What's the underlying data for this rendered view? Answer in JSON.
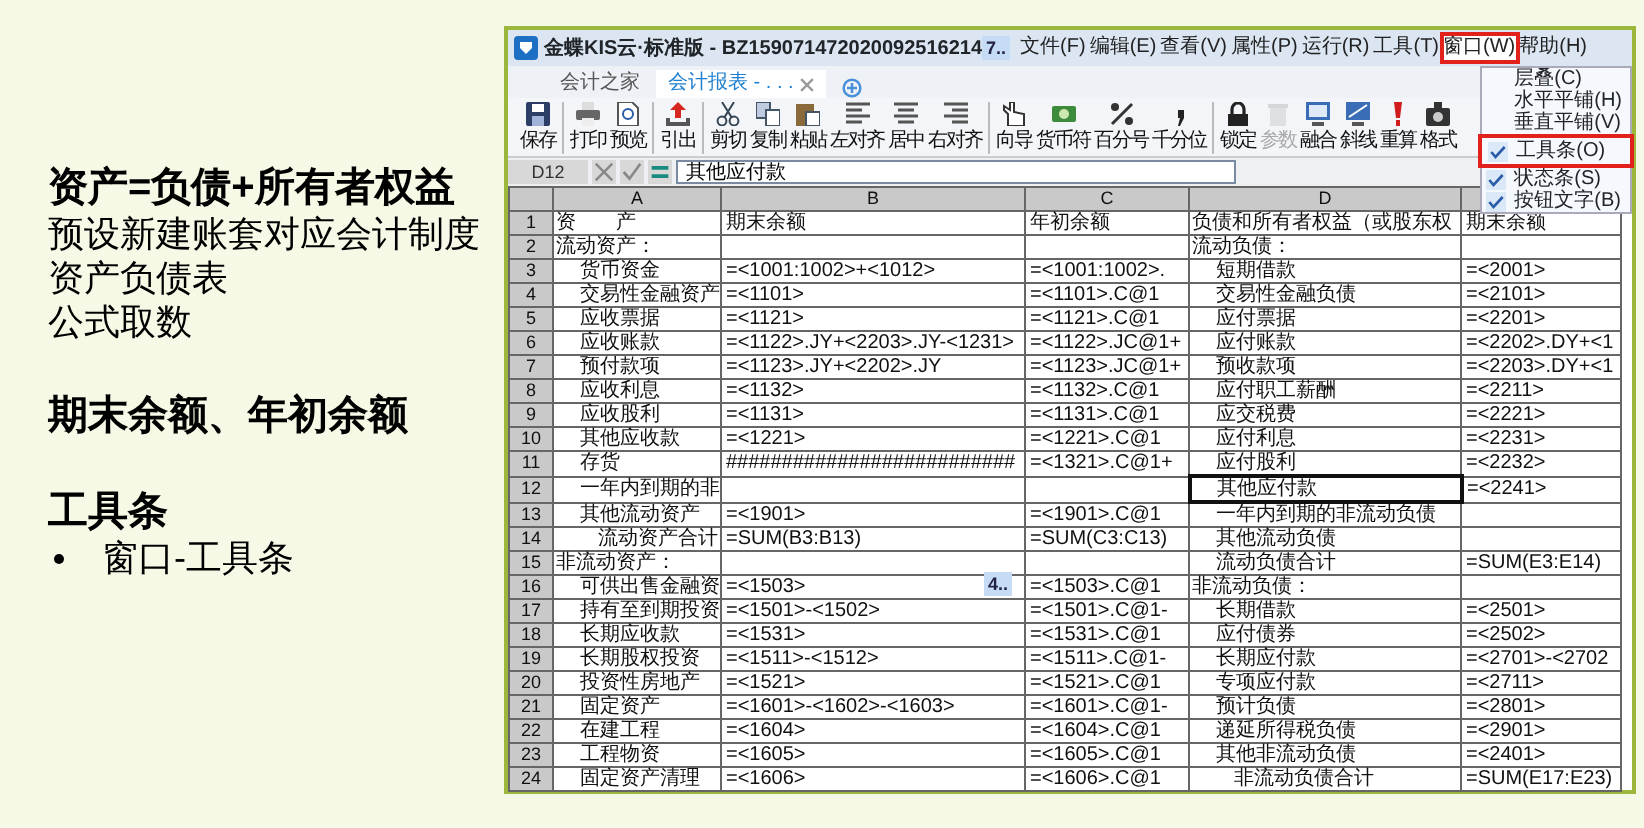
{
  "slide": {
    "sections": [
      {
        "heading": "资产=负债+所有者权益",
        "lines": [
          "预设新建账套对应会计制度",
          "资产负债表",
          "公式取数"
        ]
      },
      {
        "heading": "期末余额、年初余额"
      },
      {
        "heading": "工具条",
        "bullets": [
          "窗口-工具条"
        ]
      }
    ]
  },
  "window": {
    "title": "金蝶KIS云·标准版 - BZ159071472020092516214",
    "tooltip": "7..",
    "menus": [
      {
        "label": "文件(F)",
        "selected": false,
        "annotated": false
      },
      {
        "label": "编辑(E)",
        "selected": false,
        "annotated": false
      },
      {
        "label": "查看(V)",
        "selected": false,
        "annotated": false
      },
      {
        "label": "属性(P)",
        "selected": false,
        "annotated": false
      },
      {
        "label": "运行(R)",
        "selected": false,
        "annotated": false
      },
      {
        "label": "工具(T)",
        "selected": false,
        "annotated": false
      },
      {
        "label": "窗口(W)",
        "selected": true,
        "annotated": true
      },
      {
        "label": "帮助(H)",
        "selected": false,
        "annotated": false
      }
    ]
  },
  "window_menu": {
    "items": [
      {
        "label": "层叠(C)",
        "checked": false,
        "annotated": false
      },
      {
        "label": "水平平铺(H)",
        "checked": false,
        "annotated": false
      },
      {
        "label": "垂直平铺(V)",
        "checked": false,
        "annotated": false
      },
      {
        "label": "工具条(O)",
        "checked": true,
        "annotated": true
      },
      {
        "label": "状态条(S)",
        "checked": true,
        "annotated": false
      },
      {
        "label": "按钮文字(B)",
        "checked": true,
        "annotated": false
      }
    ]
  },
  "tabs": [
    {
      "label": "会计之家",
      "selected": false,
      "closable": false
    },
    {
      "label": "会计报表 - . . .",
      "selected": true,
      "closable": true
    }
  ],
  "toolbar": {
    "groups": [
      [
        {
          "label": "保存",
          "disabled": false
        }
      ],
      [
        {
          "label": "打印",
          "disabled": false
        },
        {
          "label": "预览",
          "disabled": false
        }
      ],
      [
        {
          "label": "引出",
          "disabled": false
        }
      ],
      [
        {
          "label": "剪切",
          "disabled": false
        },
        {
          "label": "复制",
          "disabled": false
        },
        {
          "label": "粘贴",
          "disabled": false
        },
        {
          "label": "左对齐",
          "disabled": false
        },
        {
          "label": "居中",
          "disabled": false
        },
        {
          "label": "右对齐",
          "disabled": false
        }
      ],
      [
        {
          "label": "向导",
          "disabled": false
        },
        {
          "label": "货币符",
          "disabled": false
        },
        {
          "label": "百分号",
          "disabled": false
        },
        {
          "label": "千分位",
          "disabled": false
        }
      ],
      [
        {
          "label": "锁定",
          "disabled": false
        },
        {
          "label": "参数",
          "disabled": true
        },
        {
          "label": "融合",
          "disabled": false
        },
        {
          "label": "斜线",
          "disabled": false
        },
        {
          "label": "重算",
          "disabled": false
        },
        {
          "label": "格式",
          "disabled": false
        }
      ]
    ]
  },
  "formula_bar": {
    "cell": "D12",
    "value": "其他应付款"
  },
  "sheet": {
    "columns": [
      "A",
      "B",
      "C",
      "D"
    ],
    "tooltip": "4..",
    "rows": [
      {
        "number": "1",
        "a": {
          "text": "资　　产",
          "kind": "section"
        },
        "b": "期末余额",
        "c": "年初余额",
        "d": {
          "text": "负债和所有者权益（或股东权",
          "kind": "section",
          "selected": false
        },
        "e": "期末余额"
      },
      {
        "number": "2",
        "a": {
          "text": "流动资产：",
          "kind": "section"
        },
        "d": {
          "text": "流动负债：",
          "kind": "section",
          "selected": false
        }
      },
      {
        "number": "3",
        "a": {
          "text": "货币资金",
          "kind": "item"
        },
        "b": "=<1001:1002>+<1012>",
        "c": "=<1001:1002>.",
        "d": {
          "text": "短期借款",
          "kind": "item",
          "selected": false
        },
        "e": "=<2001>"
      },
      {
        "number": "4",
        "a": {
          "text": "交易性金融资产",
          "kind": "item"
        },
        "b": "=<1101>",
        "c": "=<1101>.C@1",
        "d": {
          "text": "交易性金融负债",
          "kind": "item",
          "selected": false
        },
        "e": "=<2101>"
      },
      {
        "number": "5",
        "a": {
          "text": "应收票据",
          "kind": "item"
        },
        "b": "=<1121>",
        "c": "=<1121>.C@1",
        "d": {
          "text": "应付票据",
          "kind": "item",
          "selected": false
        },
        "e": "=<2201>"
      },
      {
        "number": "6",
        "a": {
          "text": "应收账款",
          "kind": "item"
        },
        "b": "=<1122>.JY+<2203>.JY-<1231>",
        "c": "=<1122>.JC@1+",
        "d": {
          "text": "应付账款",
          "kind": "item",
          "selected": false
        },
        "e": "=<2202>.DY+<1"
      },
      {
        "number": "7",
        "a": {
          "text": "预付款项",
          "kind": "item"
        },
        "b": "=<1123>.JY+<2202>.JY",
        "c": "=<1123>.JC@1+",
        "d": {
          "text": "预收款项",
          "kind": "item",
          "selected": false
        },
        "e": "=<2203>.DY+<1"
      },
      {
        "number": "8",
        "a": {
          "text": "应收利息",
          "kind": "item"
        },
        "b": "=<1132>",
        "c": "=<1132>.C@1",
        "d": {
          "text": "应付职工薪酬",
          "kind": "item",
          "selected": false
        },
        "e": "=<2211>"
      },
      {
        "number": "9",
        "a": {
          "text": "应收股利",
          "kind": "item"
        },
        "b": "=<1131>",
        "c": "=<1131>.C@1",
        "d": {
          "text": "应交税费",
          "kind": "item",
          "selected": false
        },
        "e": "=<2221>"
      },
      {
        "number": "10",
        "a": {
          "text": "其他应收款",
          "kind": "item"
        },
        "b": "=<1221>",
        "c": "=<1221>.C@1",
        "d": {
          "text": "应付利息",
          "kind": "item",
          "selected": false
        },
        "e": "=<2231>"
      },
      {
        "number": "11",
        "a": {
          "text": "存货",
          "kind": "item"
        },
        "b": "##########################",
        "c": "=<1321>.C@1+",
        "d": {
          "text": "应付股利",
          "kind": "item",
          "selected": false
        },
        "e": "=<2232>"
      },
      {
        "number": "12",
        "a": {
          "text": "一年内到期的非",
          "kind": "item"
        },
        "d": {
          "text": "其他应付款",
          "kind": "item",
          "selected": true
        },
        "e": "=<2241>"
      },
      {
        "number": "13",
        "a": {
          "text": "其他流动资产",
          "kind": "item"
        },
        "b": "=<1901>",
        "c": "=<1901>.C@1",
        "d": {
          "text": "一年内到期的非流动负债",
          "kind": "item",
          "selected": false
        }
      },
      {
        "number": "14",
        "a": {
          "text": "流动资产合计",
          "kind": "total"
        },
        "b": "=SUM(B3:B13)",
        "c": "=SUM(C3:C13)",
        "d": {
          "text": "其他流动负债",
          "kind": "item",
          "selected": false
        }
      },
      {
        "number": "15",
        "a": {
          "text": "非流动资产：",
          "kind": "section"
        },
        "d": {
          "text": "流动负债合计",
          "kind": "item",
          "selected": false
        },
        "e": "=SUM(E3:E14)"
      },
      {
        "number": "16",
        "a": {
          "text": "可供出售金融资",
          "kind": "item"
        },
        "b": "=<1503>",
        "c": "=<1503>.C@1",
        "d": {
          "text": "非流动负债：",
          "kind": "section",
          "selected": false
        }
      },
      {
        "number": "17",
        "a": {
          "text": "持有至到期投资",
          "kind": "item"
        },
        "b": "=<1501>-<1502>",
        "c": "=<1501>.C@1-",
        "d": {
          "text": "长期借款",
          "kind": "item",
          "selected": false
        },
        "e": "=<2501>"
      },
      {
        "number": "18",
        "a": {
          "text": "长期应收款",
          "kind": "item"
        },
        "b": "=<1531>",
        "c": "=<1531>.C@1",
        "d": {
          "text": "应付债券",
          "kind": "item",
          "selected": false
        },
        "e": "=<2502>"
      },
      {
        "number": "19",
        "a": {
          "text": "长期股权投资",
          "kind": "item"
        },
        "b": "=<1511>-<1512>",
        "c": "=<1511>.C@1-",
        "d": {
          "text": "长期应付款",
          "kind": "item",
          "selected": false
        },
        "e": "=<2701>-<2702"
      },
      {
        "number": "20",
        "a": {
          "text": "投资性房地产",
          "kind": "item"
        },
        "b": "=<1521>",
        "c": "=<1521>.C@1",
        "d": {
          "text": "专项应付款",
          "kind": "item",
          "selected": false
        },
        "e": "=<2711>"
      },
      {
        "number": "21",
        "a": {
          "text": "固定资产",
          "kind": "item"
        },
        "b": "=<1601>-<1602>-<1603>",
        "c": "=<1601>.C@1-",
        "d": {
          "text": "预计负债",
          "kind": "item",
          "selected": false
        },
        "e": "=<2801>"
      },
      {
        "number": "22",
        "a": {
          "text": "在建工程",
          "kind": "item"
        },
        "b": "=<1604>",
        "c": "=<1604>.C@1",
        "d": {
          "text": "递延所得税负债",
          "kind": "item",
          "selected": false
        },
        "e": "=<2901>"
      },
      {
        "number": "23",
        "a": {
          "text": "工程物资",
          "kind": "item"
        },
        "b": "=<1605>",
        "c": "=<1605>.C@1",
        "d": {
          "text": "其他非流动负债",
          "kind": "item",
          "selected": false
        },
        "e": "=<2401>"
      },
      {
        "number": "24",
        "a": {
          "text": "固定资产清理",
          "kind": "item"
        },
        "b": "=<1606>",
        "c": "=<1606>.C@1",
        "d": {
          "text": "非流动负债合计",
          "kind": "total",
          "selected": false
        },
        "e": "=SUM(E17:E23)"
      }
    ]
  }
}
